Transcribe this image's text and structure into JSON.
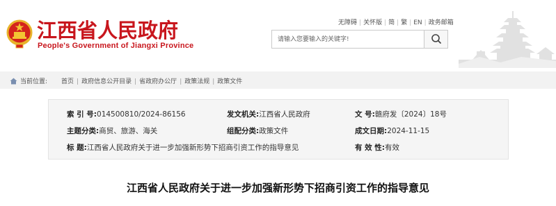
{
  "header": {
    "title": "江西省人民政府",
    "subtitle": "People's Government of Jiangxi Province",
    "toplinks": [
      "无障碍",
      "关怀版",
      "简",
      "繁",
      "EN",
      "政务邮箱"
    ]
  },
  "search": {
    "placeholder": "请输入您要输入的关键字!"
  },
  "breadcrumb": {
    "current_label": "当前位置:",
    "items": [
      "首页",
      "政府信息公开目录",
      "省政府办公厅",
      "政策法规",
      "政策文件"
    ]
  },
  "meta": {
    "index": {
      "label": "索  引 号:",
      "value": "014500810/2024-86156"
    },
    "issuer": {
      "label": "发文机关:",
      "value": "江西省人民政府"
    },
    "doc_no": {
      "label": "文       号:",
      "value": "赣府发〔2024〕18号"
    },
    "subject": {
      "label": "主题分类:",
      "value": "商贸、旅游、海关"
    },
    "genre": {
      "label": "组配分类:",
      "value": "政策文件"
    },
    "date": {
      "label": "成文日期:",
      "value": "2024-11-15"
    },
    "title": {
      "label": "标       题:",
      "value": "江西省人民政府关于进一步加强新形势下招商引资工作的指导意见"
    },
    "validity": {
      "label": "有  效  性:",
      "value": "有效"
    }
  },
  "document": {
    "title": "江西省人民政府关于进一步加强新形势下招商引资工作的指导意见"
  },
  "colors": {
    "brand_red": "#c8161d",
    "crumb_bg": "#f2f2f2",
    "panel_bg": "#f5f5f5"
  }
}
